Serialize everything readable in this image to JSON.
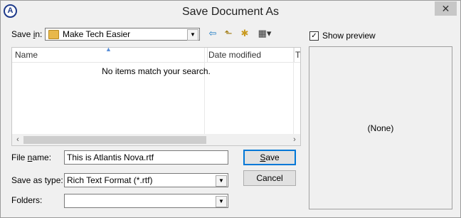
{
  "window": {
    "title": "Save Document As",
    "app_icon_letter": "A",
    "close_glyph": "✕"
  },
  "toolbar": {
    "save_in_label_pre": "Save ",
    "save_in_label_key": "i",
    "save_in_label_post": "n:",
    "save_in_value": "Make Tech Easier",
    "icons": [
      "back-arrow-icon",
      "up-folder-icon",
      "new-folder-icon",
      "view-menu-icon"
    ]
  },
  "file_list": {
    "columns": [
      "Name",
      "Date modified",
      "Ty"
    ],
    "empty_message": "No items match your search."
  },
  "form": {
    "file_name_label_pre": "File ",
    "file_name_label_key": "n",
    "file_name_label_post": "ame:",
    "file_name_value": "This is Atlantis Nova.rtf",
    "save_as_type_label": "Save as type:",
    "save_as_type_value": "Rich Text Format (*.rtf)",
    "folders_label": "Folders:",
    "folders_value": ""
  },
  "buttons": {
    "save_key": "S",
    "save_rest": "ave",
    "cancel": "Cancel"
  },
  "preview": {
    "show_preview_label": "Show preview",
    "show_preview_checked": true,
    "content": "(None)"
  }
}
